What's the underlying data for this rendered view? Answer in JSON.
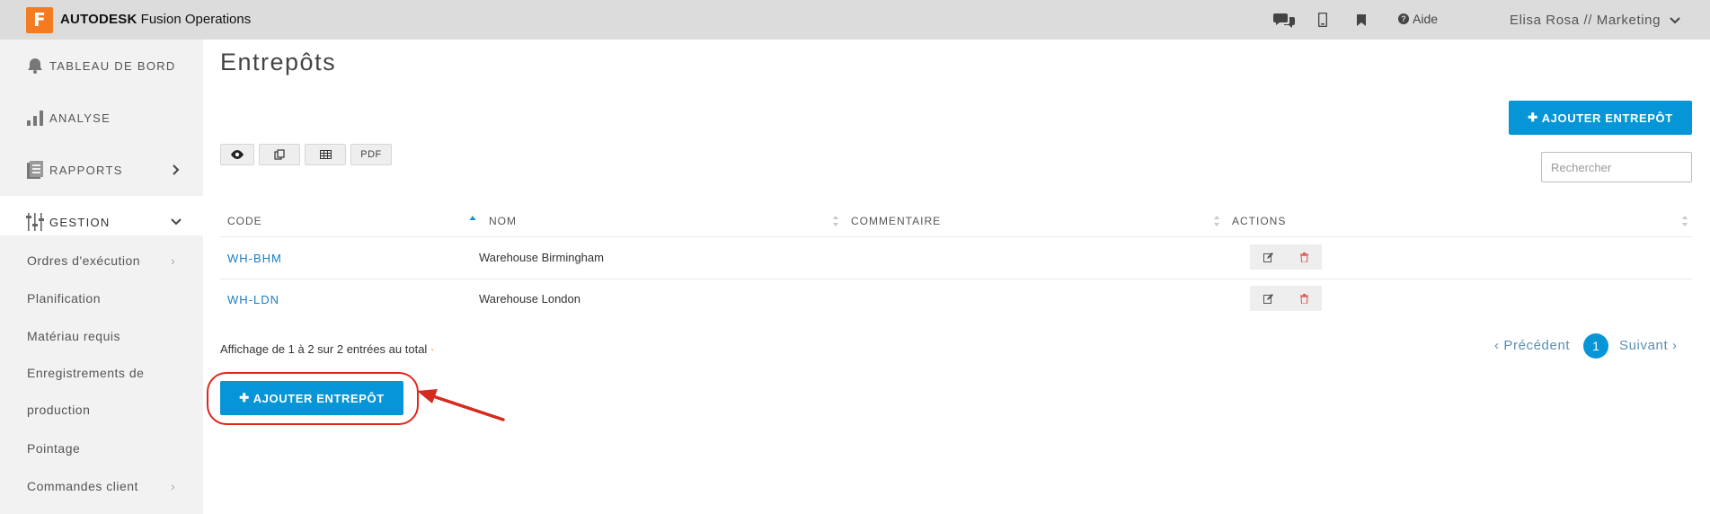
{
  "brand": {
    "logo_letter": "F",
    "name_bold": "AUTODESK",
    "name_rest": " Fusion Operations"
  },
  "topbar": {
    "icons": [
      "chat-icon",
      "mobile-icon",
      "bookmark-icon"
    ],
    "help_label": "Aide",
    "user_label": "Elisa Rosa // Marketing"
  },
  "sidebar": {
    "main_items": [
      {
        "label": "TABLEAU DE BORD",
        "icon": "bell-icon"
      },
      {
        "label": "ANALYSE",
        "icon": "bar-chart-icon"
      },
      {
        "label": "RAPPORTS",
        "icon": "reports-icon"
      },
      {
        "label": "GESTION",
        "icon": "sliders-icon"
      }
    ],
    "sub_items": [
      {
        "label": "Ordres d'exécution"
      },
      {
        "label": "Planification"
      },
      {
        "label": "Matériau requis"
      },
      {
        "label_line1": "Enregistrements de",
        "label_line2": "production"
      },
      {
        "label": "Pointage"
      },
      {
        "label": "Commandes client"
      }
    ]
  },
  "main": {
    "title": "Entrepôts",
    "add_button_label": "AJOUTER ENTREPÔT",
    "toolbar": {
      "pdf_label": "PDF"
    },
    "search": {
      "placeholder": "Rechercher",
      "value": ""
    },
    "table": {
      "columns": [
        "CODE",
        "NOM",
        "COMMENTAIRE",
        "ACTIONS"
      ],
      "rows": [
        {
          "code": "WH-BHM",
          "name": "Warehouse Birmingham",
          "comment": ""
        },
        {
          "code": "WH-LDN",
          "name": "Warehouse London",
          "comment": ""
        }
      ]
    },
    "info_text": "Affichage de 1 à 2 sur 2 entrées au total",
    "pagination": {
      "prev_label": "Précédent",
      "current_page": "1",
      "next_label": "Suivant"
    },
    "bottom_add_button_label": "AJOUTER ENTREPÔT"
  },
  "colors": {
    "accent": "#0696d7",
    "logo": "#f47b20",
    "highlight": "#e0261c",
    "delete": "#e05a5a"
  }
}
